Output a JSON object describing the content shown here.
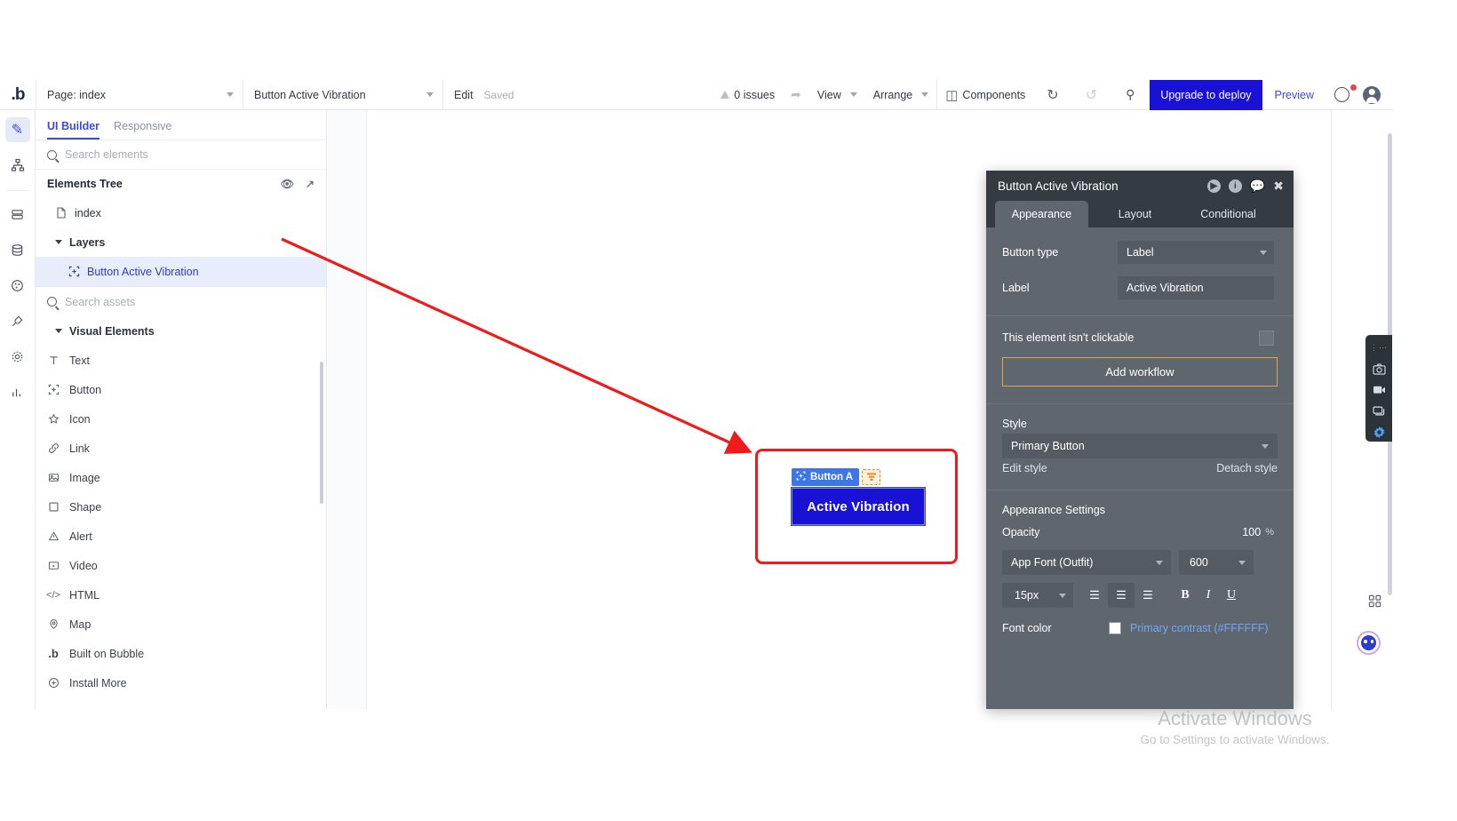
{
  "topbar": {
    "logo": ".b",
    "page_select": "Page: index",
    "element_select": "Button Active Vibration",
    "edit_label": "Edit",
    "saved_label": "Saved",
    "issues_label": "0 issues",
    "view_label": "View",
    "arrange_label": "Arrange",
    "components_label": "Components",
    "upgrade_label": "Upgrade to deploy",
    "preview_label": "Preview",
    "accent_blue": "#1a11d6"
  },
  "left_rail": {
    "items": [
      {
        "name": "design-pencil",
        "glyph": "✎",
        "active": true
      },
      {
        "name": "workflow-node",
        "glyph": "⛓",
        "active": false
      },
      {
        "name": "data-rows",
        "glyph": "☰",
        "active": false
      },
      {
        "name": "database",
        "glyph": "⛃",
        "active": false
      },
      {
        "name": "styles-palette",
        "glyph": "◑",
        "active": false
      },
      {
        "name": "plugins-plug",
        "glyph": "⚡",
        "active": false
      },
      {
        "name": "settings-gear",
        "glyph": "⚙",
        "active": false
      },
      {
        "name": "logs-chart",
        "glyph": "‖",
        "active": false
      }
    ]
  },
  "left_panel": {
    "tabs": [
      {
        "label": "UI Builder",
        "active": true
      },
      {
        "label": "Responsive",
        "active": false
      }
    ],
    "search_elements_placeholder": "Search elements",
    "elements_tree_title": "Elements Tree",
    "tree": [
      {
        "label": "index",
        "icon": "page-icon",
        "depth": 0,
        "selected": false,
        "expander": false
      },
      {
        "label": "Layers",
        "icon": "none",
        "depth": 0,
        "selected": false,
        "expander": true
      },
      {
        "label": "Button Active Vibration",
        "icon": "button-icon",
        "depth": 1,
        "selected": true,
        "expander": false
      }
    ],
    "search_assets_placeholder": "Search assets",
    "visual_elements_title": "Visual Elements",
    "visual_elements": [
      {
        "label": "Text",
        "icon": "text-icon"
      },
      {
        "label": "Button",
        "icon": "button-icon"
      },
      {
        "label": "Icon",
        "icon": "star-icon"
      },
      {
        "label": "Link",
        "icon": "link-icon"
      },
      {
        "label": "Image",
        "icon": "image-icon"
      },
      {
        "label": "Shape",
        "icon": "square-icon"
      },
      {
        "label": "Alert",
        "icon": "warning-icon"
      },
      {
        "label": "Video",
        "icon": "video-icon"
      },
      {
        "label": "HTML",
        "icon": "code-icon"
      },
      {
        "label": "Map",
        "icon": "pin-icon"
      },
      {
        "label": "Built on Bubble",
        "icon": "bubble-icon"
      },
      {
        "label": "Install More",
        "icon": "plus-circle-icon"
      }
    ]
  },
  "canvas": {
    "element_badge": "Button A",
    "button_text": "Active Vibration",
    "button_color": "#1a11d6",
    "annotation_color": "#ef1b1b"
  },
  "properties": {
    "title": "Button Active Vibration",
    "tabs": [
      {
        "label": "Appearance",
        "active": true
      },
      {
        "label": "Layout",
        "active": false
      },
      {
        "label": "Conditional",
        "active": false
      }
    ],
    "button_type_label": "Button type",
    "button_type_value": "Label",
    "label_label": "Label",
    "label_value": "Active Vibration",
    "not_clickable_text": "This element isn't clickable",
    "add_workflow_label": "Add workflow",
    "style_label": "Style",
    "style_value": "Primary Button",
    "edit_style_label": "Edit style",
    "detach_style_label": "Detach style",
    "appearance_settings_label": "Appearance Settings",
    "opacity_label": "Opacity",
    "opacity_value": "100",
    "opacity_unit": "%",
    "font_family_value": "App Font (Outfit)",
    "font_weight_value": "600",
    "font_size_value": "15px",
    "font_color_label": "Font color",
    "font_color_value": "Primary contrast (#FFFFFF)",
    "font_color_swatch": "#FFFFFF",
    "workflow_border_color": "#e0a648"
  },
  "right_widgets": {
    "rail_icons": [
      "more-dots-icon",
      "camera-icon",
      "video-record-icon",
      "copy-icon",
      "gear-icon"
    ],
    "grid_icon": "grid-icon",
    "face_icon": "assistant-face-icon"
  },
  "watermark": {
    "line1": "Activate Windows",
    "line2": "Go to Settings to activate Windows."
  }
}
